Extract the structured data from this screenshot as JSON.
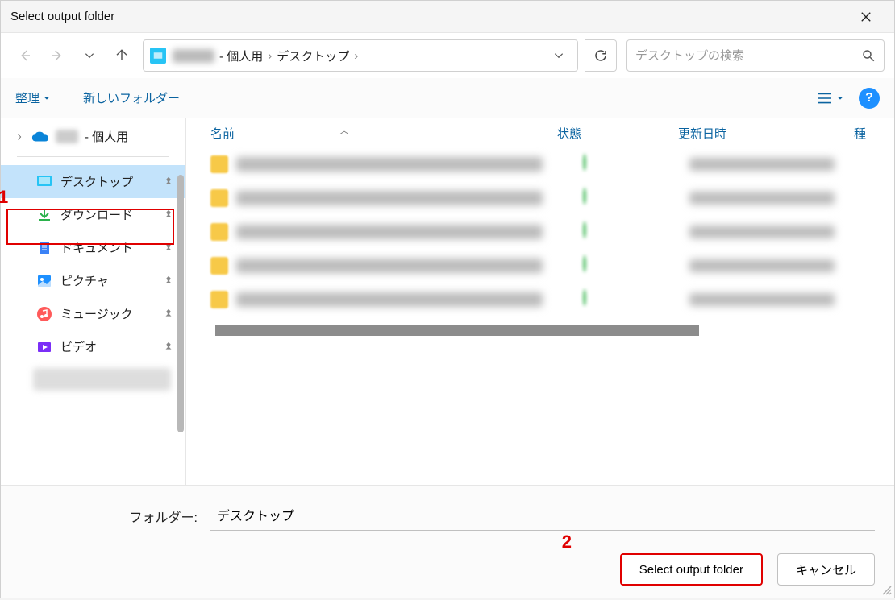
{
  "title": "Select output folder",
  "breadcrumb": {
    "hidden_segment": "XXXX",
    "segment1_suffix": "- 個人用",
    "segment2": "デスクトップ"
  },
  "search": {
    "placeholder": "デスクトップの検索"
  },
  "toolbar": {
    "organize": "整理",
    "new_folder": "新しいフォルダー"
  },
  "tree_root_suffix": "- 個人用",
  "sidebar": {
    "items": [
      {
        "label": "デスクトップ",
        "icon": "desktop",
        "selected": true,
        "pinned": true
      },
      {
        "label": "ダウンロード",
        "icon": "download",
        "selected": false,
        "pinned": true
      },
      {
        "label": "ドキュメント",
        "icon": "document",
        "selected": false,
        "pinned": true
      },
      {
        "label": "ピクチャ",
        "icon": "picture",
        "selected": false,
        "pinned": true
      },
      {
        "label": "ミュージック",
        "icon": "music",
        "selected": false,
        "pinned": true
      },
      {
        "label": "ビデオ",
        "icon": "video",
        "selected": false,
        "pinned": true
      }
    ]
  },
  "columns": {
    "name": "名前",
    "state": "状態",
    "date": "更新日時",
    "kind": "種"
  },
  "file_rows_count": 5,
  "footer": {
    "folder_label": "フォルダー:",
    "folder_value": "デスクトップ",
    "select_btn": "Select output folder",
    "cancel_btn": "キャンセル"
  },
  "annotations": {
    "one": "1",
    "two": "2"
  }
}
